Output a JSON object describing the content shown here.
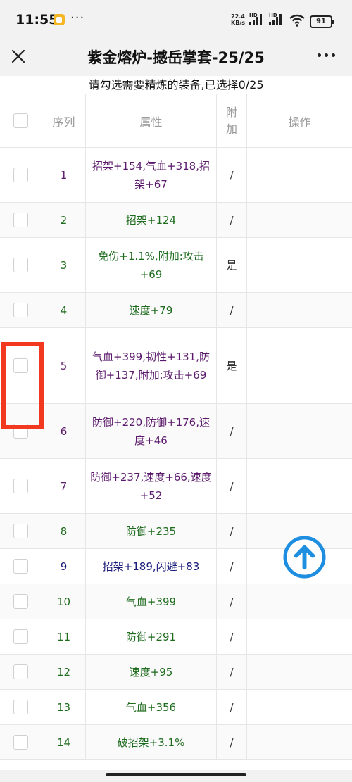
{
  "status": {
    "time": "11:55",
    "dots": "···",
    "net_speed": "22.4",
    "net_unit": "KB/s",
    "sig1_label": "HD",
    "sig2_label": "HD",
    "battery": "91"
  },
  "nav": {
    "title": "紫金熔炉-撼岳掌套-25/25"
  },
  "notice": "请勾选需要精炼的装备,已选择0/25",
  "table": {
    "headers": {
      "index": "序列",
      "attr": "属性",
      "extra_1": "附",
      "extra_2": "加",
      "action": "操作"
    },
    "rows": [
      {
        "index": "1",
        "attr": "招架+154,气血+318,招架+67",
        "extra": "/",
        "color": "#5b1a6b"
      },
      {
        "index": "2",
        "attr": "招架+124",
        "extra": "/",
        "color": "#1d6b1d"
      },
      {
        "index": "3",
        "attr": "免伤+1.1%,附加:攻击+69",
        "extra": "是",
        "color": "#1d6b1d"
      },
      {
        "index": "4",
        "attr": "速度+79",
        "extra": "/",
        "color": "#1d6b1d"
      },
      {
        "index": "5",
        "attr": "气血+399,韧性+131,防御+137,附加:攻击+69",
        "extra": "是",
        "color": "#5b1a6b"
      },
      {
        "index": "6",
        "attr": "防御+220,防御+176,速度+46",
        "extra": "/",
        "color": "#5b1a6b"
      },
      {
        "index": "7",
        "attr": "防御+237,速度+66,速度+52",
        "extra": "/",
        "color": "#5b1a6b"
      },
      {
        "index": "8",
        "attr": "防御+235",
        "extra": "/",
        "color": "#1d6b1d"
      },
      {
        "index": "9",
        "attr": "招架+189,闪避+83",
        "extra": "/",
        "color": "#1a1a7a"
      },
      {
        "index": "10",
        "attr": "气血+399",
        "extra": "/",
        "color": "#1d6b1d"
      },
      {
        "index": "11",
        "attr": "防御+291",
        "extra": "/",
        "color": "#1d6b1d"
      },
      {
        "index": "12",
        "attr": "速度+95",
        "extra": "/",
        "color": "#1d6b1d"
      },
      {
        "index": "13",
        "attr": "气血+356",
        "extra": "/",
        "color": "#1d6b1d"
      },
      {
        "index": "14",
        "attr": "破招架+3.1%",
        "extra": "/",
        "color": "#1d6b1d"
      }
    ]
  },
  "icons": {
    "close": "close-icon",
    "more": "more-icon",
    "scroll_top": "arrow-up-circle-icon"
  },
  "colors": {
    "annotation": "#f2381f",
    "scroll_top": "#1e8ee0"
  }
}
